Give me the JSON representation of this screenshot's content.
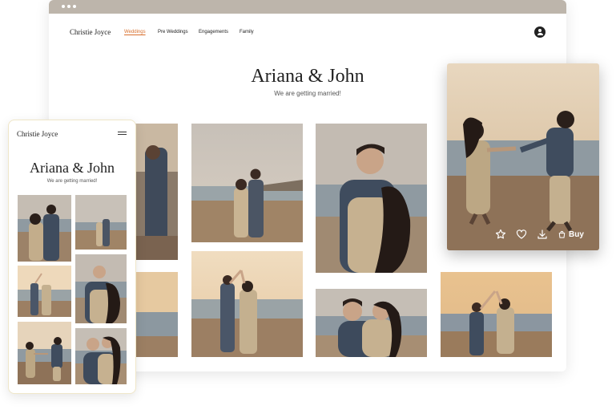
{
  "desktop": {
    "brand": "Christie Joyce",
    "nav": [
      "Weddings",
      "Pre Weddings",
      "Engagements",
      "Family"
    ],
    "active_nav": "Weddings",
    "title": "Ariana & John",
    "subtitle": "We are getting married!"
  },
  "lightbox": {
    "buy_label": "Buy",
    "actions": [
      "star-icon",
      "heart-icon",
      "download-icon",
      "cart-icon"
    ]
  },
  "mobile": {
    "brand": "Christie Joyce",
    "title": "Ariana & John",
    "subtitle": "We are getting married!"
  },
  "colors": {
    "accent": "#d8702e",
    "browser_bar": "#bdb5ab",
    "sand": "#9c7f63",
    "sky_warm": "#e6d3b8",
    "sea": "#8c98a0"
  }
}
